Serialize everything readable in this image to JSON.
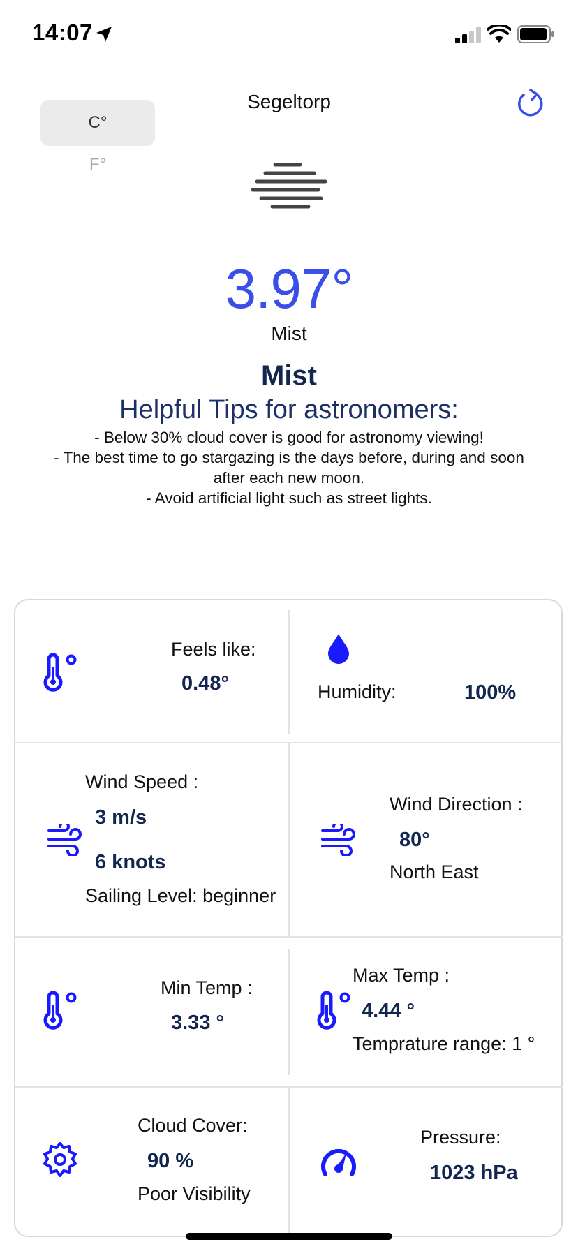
{
  "status_bar": {
    "time": "14:07"
  },
  "header": {
    "unit_celsius": "C°",
    "unit_fahrenheit": "F°",
    "city": "Segeltorp"
  },
  "weather": {
    "temperature": "3.97°",
    "description_small": "Mist",
    "description_big": "Mist"
  },
  "tips": {
    "title": "Helpful Tips for astronomers:",
    "lines": [
      "- Below 30% cloud cover is good for astronomy viewing!",
      "- The best time to go stargazing is the days before, during and soon",
      "after each new moon.",
      "- Avoid artificial light such as street lights."
    ]
  },
  "cards": {
    "feels_like": {
      "label": "Feels like:",
      "value": "0.48°"
    },
    "humidity": {
      "label": "Humidity:",
      "value": "100%"
    },
    "wind_speed": {
      "label": "Wind Speed :",
      "value_ms": "3 m/s",
      "value_knots": "6 knots",
      "sailing": "Sailing Level: beginner"
    },
    "wind_direction": {
      "label": "Wind Direction :",
      "value": "80°",
      "direction": "North East"
    },
    "min_temp": {
      "label": "Min Temp :",
      "value": "3.33 °"
    },
    "max_temp": {
      "label": "Max Temp :",
      "value": "4.44 °",
      "range": "Temprature range: 1 °"
    },
    "cloud_cover": {
      "label": "Cloud Cover:",
      "value": "90 %",
      "visibility": "Poor Visibility"
    },
    "pressure": {
      "label": "Pressure:",
      "value": "1023 hPa"
    }
  },
  "colors": {
    "accent": "#3a4ee8",
    "icon_blue": "#1a1aff",
    "dark_navy": "#13264f"
  }
}
